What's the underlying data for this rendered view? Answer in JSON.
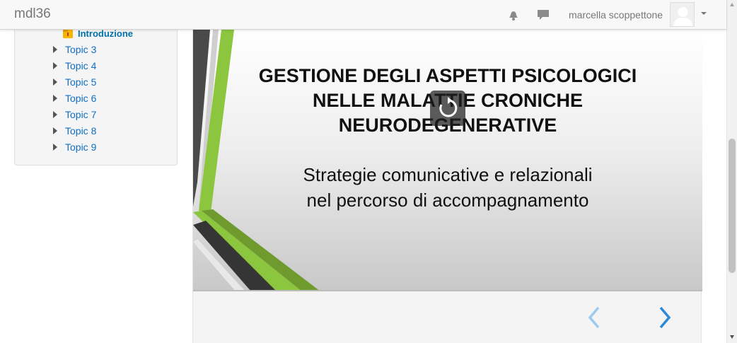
{
  "navbar": {
    "brand": "mdl36",
    "user_name": "marcella scoppettone",
    "icons": [
      "bell-icon",
      "message-icon",
      "avatar",
      "caret-down-icon"
    ]
  },
  "course_nav": {
    "current_section": "Introduzione",
    "topics": [
      "Topic 3",
      "Topic 4",
      "Topic 5",
      "Topic 6",
      "Topic 7",
      "Topic 8",
      "Topic 9"
    ]
  },
  "slide": {
    "title_lines": [
      "GESTIONE DEGLI ASPETTI PSICOLOGICI",
      "NELLE MALATTIE CRONICHE",
      "NEURODEGENERATIVE"
    ],
    "subtitle_lines": [
      "Strategie comunicative e relazionali",
      "nel percorso di accompagnamento"
    ],
    "colors": {
      "accent_green": "#8cc63f",
      "dark_stripe": "#3a3a3a",
      "nav_prev": "#9ccbef",
      "nav_next": "#2a8ad8"
    }
  }
}
